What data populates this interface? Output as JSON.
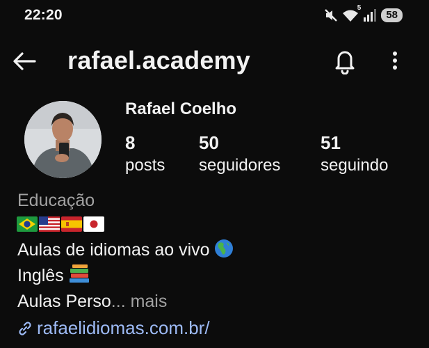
{
  "status_bar": {
    "time": "22:20",
    "battery": "58",
    "network": "5",
    "icons": [
      "mute-icon",
      "wifi-icon",
      "signal-icon",
      "battery-icon"
    ]
  },
  "header": {
    "username": "rafael.academy",
    "icons": [
      "back-arrow-icon",
      "bell-icon",
      "more-vertical-icon"
    ]
  },
  "profile": {
    "name": "Rafael Coelho",
    "stats": [
      {
        "value": "8",
        "label": "posts"
      },
      {
        "value": "50",
        "label": "seguidores"
      },
      {
        "value": "51",
        "label": "seguindo"
      }
    ]
  },
  "bio": {
    "category": "Educação",
    "flags": [
      "brazil-flag",
      "usa-flag",
      "spain-flag",
      "japan-flag"
    ],
    "line1": "Aulas de idiomas ao vivo",
    "line1_emoji": "globe-americas-icon",
    "line2": "Inglês",
    "line2_emoji": "books-icon",
    "line3": "Aulas Perso",
    "more": "... mais",
    "website": "rafaelidiomas.com.br/"
  },
  "colors": {
    "background": "#0c0c0c",
    "text": "#f2f2f2",
    "secondary_text": "#a2a2a2",
    "link": "#9dbaf5"
  }
}
